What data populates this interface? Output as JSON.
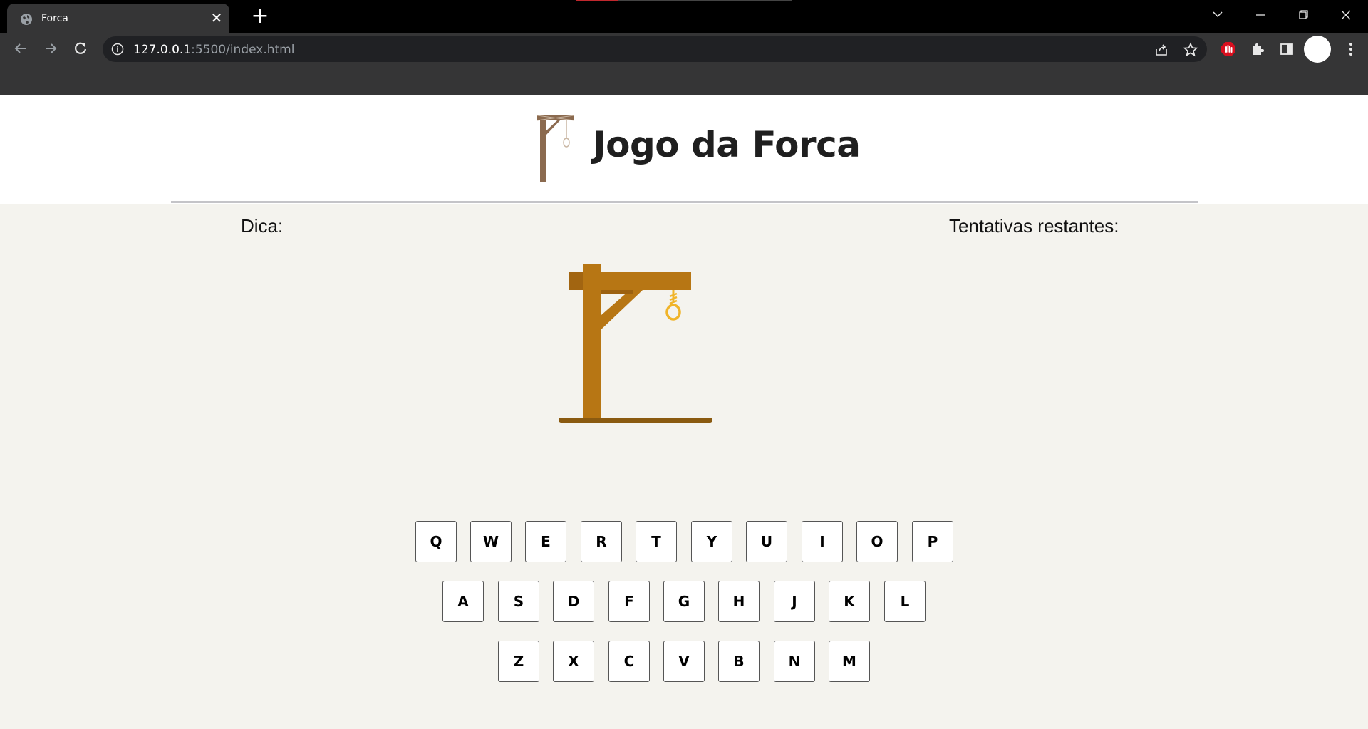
{
  "browser": {
    "tab_title": "Forca",
    "url_host": "127.0.0.1",
    "url_rest": ":5500/index.html",
    "close_glyph": "✕",
    "new_tab_glyph": "+"
  },
  "page": {
    "title": "Jogo da Forca",
    "hint_label": "Dica:",
    "tries_label": "Tentativas restantes:"
  },
  "keyboard": {
    "row1": [
      "Q",
      "W",
      "E",
      "R",
      "T",
      "Y",
      "U",
      "I",
      "O",
      "P"
    ],
    "row2": [
      "A",
      "S",
      "D",
      "F",
      "G",
      "H",
      "J",
      "K",
      "L"
    ],
    "row3": [
      "Z",
      "X",
      "C",
      "V",
      "B",
      "N",
      "M"
    ]
  },
  "colors": {
    "wood": "#b77614",
    "wood_dark": "#8a5a10",
    "rope": "#f0b429",
    "background": "#f4f3ee"
  }
}
